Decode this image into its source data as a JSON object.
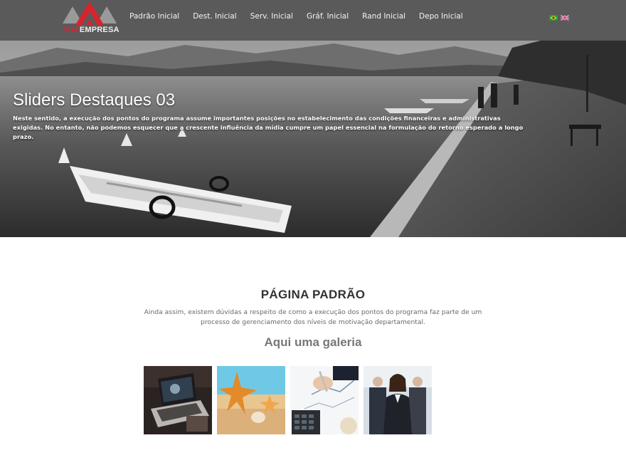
{
  "header": {
    "logo": {
      "accent": "SUA",
      "plain": "EMPRESA"
    },
    "nav": [
      {
        "label": "Padrão Inicial"
      },
      {
        "label": "Dest. Inicial"
      },
      {
        "label": "Serv. Inicial"
      },
      {
        "label": "Gráf. Inicial"
      },
      {
        "label": "Rand Inicial"
      },
      {
        "label": "Depo Inicial"
      }
    ],
    "flags": [
      {
        "icon": "brazil-flag-icon"
      },
      {
        "icon": "uk-flag-icon"
      }
    ]
  },
  "hero": {
    "title": "Sliders Destaques 03",
    "text": "Neste sentido, a execução dos pontos do programa assume importantes posições no estabelecimento das condições financeiras e administrativas exigidas. No entanto, não podemos esquecer que a crescente influência da mídia cumpre um papel essencial na formulação do retorno esperado a longo prazo."
  },
  "main": {
    "title": "PÁGINA PADRÃO",
    "description": "Ainda assim, existem dúvidas a respeito de como a execução dos pontos do programa faz parte de um processo de gerenciamento dos níveis de motivação departamental.",
    "gallery_title": "Aqui uma galeria",
    "gallery": [
      {
        "icon": "laptop-photo"
      },
      {
        "icon": "starfish-beach-photo"
      },
      {
        "icon": "hand-calculator-photo"
      },
      {
        "icon": "business-team-photo"
      }
    ]
  },
  "colors": {
    "header_bg": "#5a5a5a",
    "logo_accent": "#d9232d",
    "text_dark": "#333333"
  }
}
